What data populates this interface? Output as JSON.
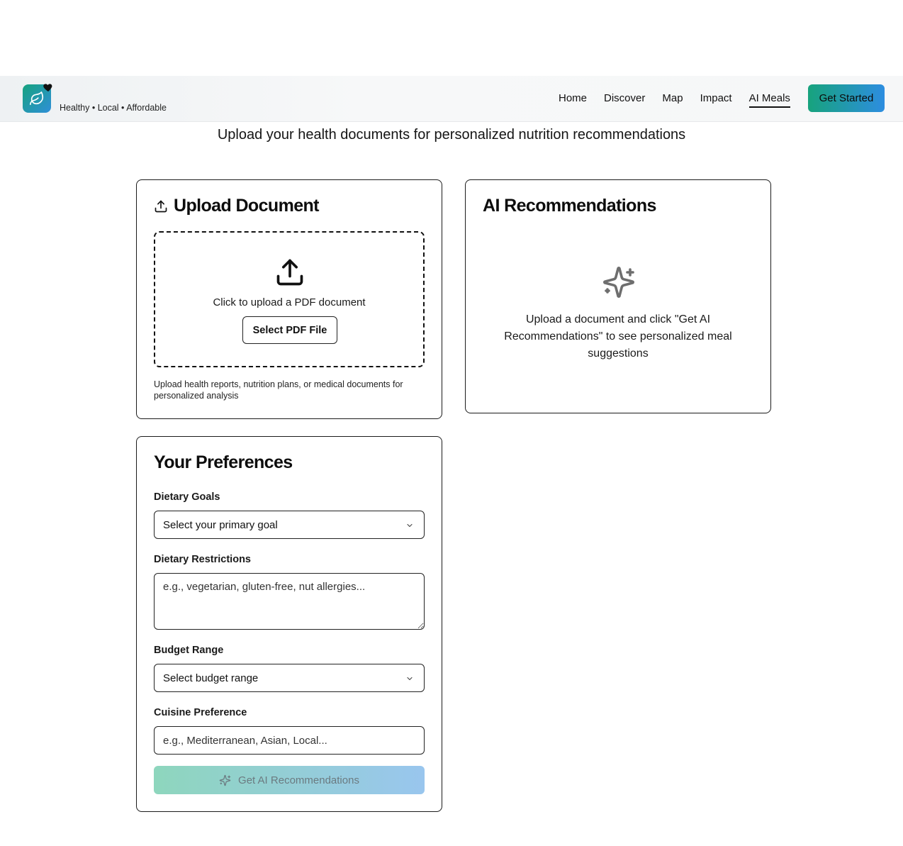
{
  "header": {
    "tagline": "Healthy • Local • Affordable",
    "nav": [
      "Home",
      "Discover",
      "Map",
      "Impact",
      "AI Meals"
    ],
    "active_nav": "AI Meals",
    "cta_label": "Get Started"
  },
  "subtitle": "Upload your health documents for personalized nutrition recommendations",
  "upload": {
    "title": "Upload Document",
    "dropzone_text": "Click to upload a PDF document",
    "select_button": "Select PDF File",
    "hint": "Upload health reports, nutrition plans, or medical documents for personalized analysis"
  },
  "recommendations": {
    "title": "AI Recommendations",
    "empty_text": "Upload a document and click \"Get AI Recommendations\" to see personalized meal suggestions"
  },
  "preferences": {
    "title": "Your Preferences",
    "dietary_goals_label": "Dietary Goals",
    "dietary_goals_value": "Select your primary goal",
    "restrictions_label": "Dietary Restrictions",
    "restrictions_placeholder": "e.g., vegetarian, gluten-free, nut allergies...",
    "budget_label": "Budget Range",
    "budget_value": "Select budget range",
    "cuisine_label": "Cuisine Preference",
    "cuisine_placeholder": "e.g., Mediterranean, Asian, Local...",
    "submit_label": "Get AI Recommendations"
  },
  "colors": {
    "brand_green": "#17a37d",
    "brand_blue": "#2d8de0"
  }
}
